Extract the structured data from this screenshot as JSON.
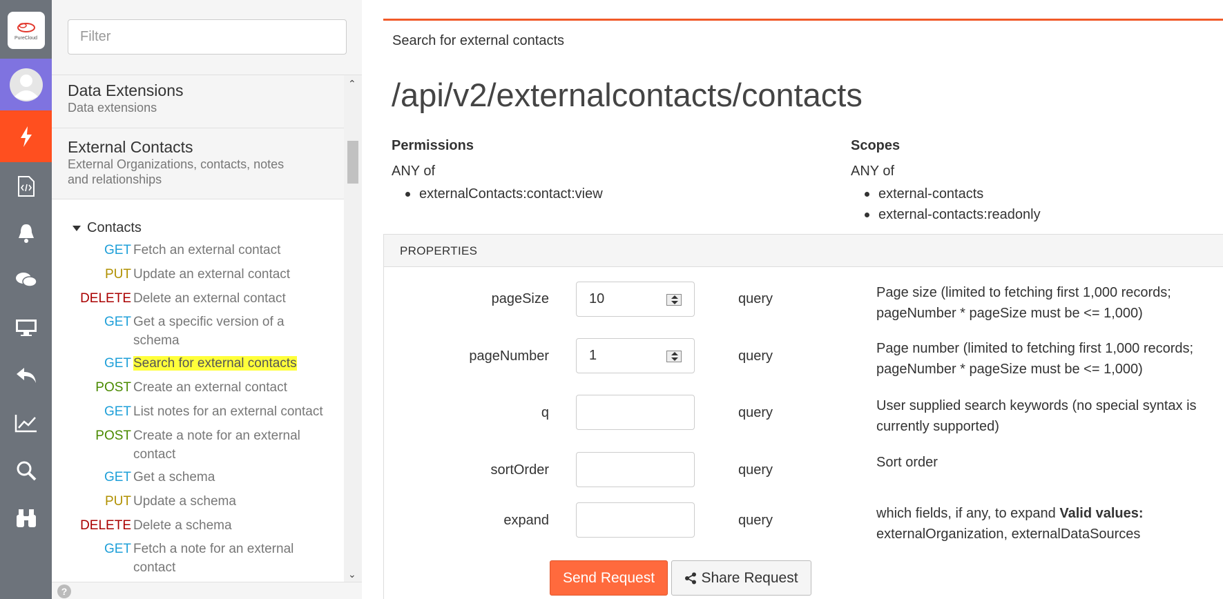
{
  "rail": {
    "logo_text": "PureCloud",
    "icons": [
      "purecloud-logo-icon",
      "avatar-icon",
      "lightning-icon",
      "code-document-icon",
      "bell-icon",
      "chat-icon",
      "monitor-icon",
      "reply-icon",
      "chart-icon",
      "search-icon",
      "binoculars-icon"
    ],
    "active_color": "#ff4f1f",
    "avatar_bg": "#7f73e0"
  },
  "sidebar": {
    "filter_placeholder": "Filter",
    "categories": [
      {
        "title": "Data Extensions",
        "subtitle": "Data extensions"
      },
      {
        "title": "External Contacts",
        "subtitle_line1": "External Organizations, contacts, notes",
        "subtitle_line2": "and relationships"
      }
    ],
    "group": "Contacts",
    "operations": [
      {
        "method": "GET",
        "label": "Fetch an external contact"
      },
      {
        "method": "PUT",
        "label": "Update an external contact"
      },
      {
        "method": "DELETE",
        "label": "Delete an external contact"
      },
      {
        "method": "GET",
        "label_line1": "Get a specific version of a",
        "label_line2": "schema"
      },
      {
        "method": "GET",
        "label": "Search for external contacts"
      },
      {
        "method": "POST",
        "label": "Create an external contact"
      },
      {
        "method": "GET",
        "label": "List notes for an external contact"
      },
      {
        "method": "POST",
        "label_line1": "Create a note for an external",
        "label_line2": "contact"
      },
      {
        "method": "GET",
        "label": "Get a schema"
      },
      {
        "method": "PUT",
        "label": "Update a schema"
      },
      {
        "method": "DELETE",
        "label": "Delete a schema"
      },
      {
        "method": "GET",
        "label_line1": "Fetch a note for an external",
        "label_line2": "contact"
      }
    ],
    "help_glyph": "?"
  },
  "main": {
    "summary": "Search for external contacts",
    "path": "/api/v2/externalcontacts/contacts",
    "permissions": {
      "title": "Permissions",
      "any": "ANY of",
      "items": [
        "externalContacts:contact:view"
      ]
    },
    "scopes": {
      "title": "Scopes",
      "any": "ANY of",
      "items": [
        "external-contacts",
        "external-contacts:readonly"
      ]
    },
    "properties_header": "PROPERTIES",
    "params": [
      {
        "name": "pageSize",
        "value": "10",
        "location": "query",
        "desc_line1": "Page size (limited to fetching first 1,000 records;",
        "desc_line2": "pageNumber * pageSize must be <= 1,000)"
      },
      {
        "name": "pageNumber",
        "value": "1",
        "location": "query",
        "desc_line1": "Page number (limited to fetching first 1,000 records;",
        "desc_line2": "pageNumber * pageSize must be <= 1,000)"
      },
      {
        "name": "q",
        "value": "",
        "location": "query",
        "desc_line1": "User supplied search keywords (no special syntax is",
        "desc_line2": "currently supported)"
      },
      {
        "name": "sortOrder",
        "value": "",
        "location": "query",
        "desc_line1": "Sort order",
        "desc_line2": ""
      },
      {
        "name": "expand",
        "value": "",
        "location": "query",
        "desc_line1": "which fields, if any, to expand ",
        "desc_bold": "Valid values:",
        "desc_line2": "externalOrganization, externalDataSources"
      }
    ],
    "send_label": "Send Request",
    "share_label": "Share Request",
    "accent": "#f15a29"
  }
}
